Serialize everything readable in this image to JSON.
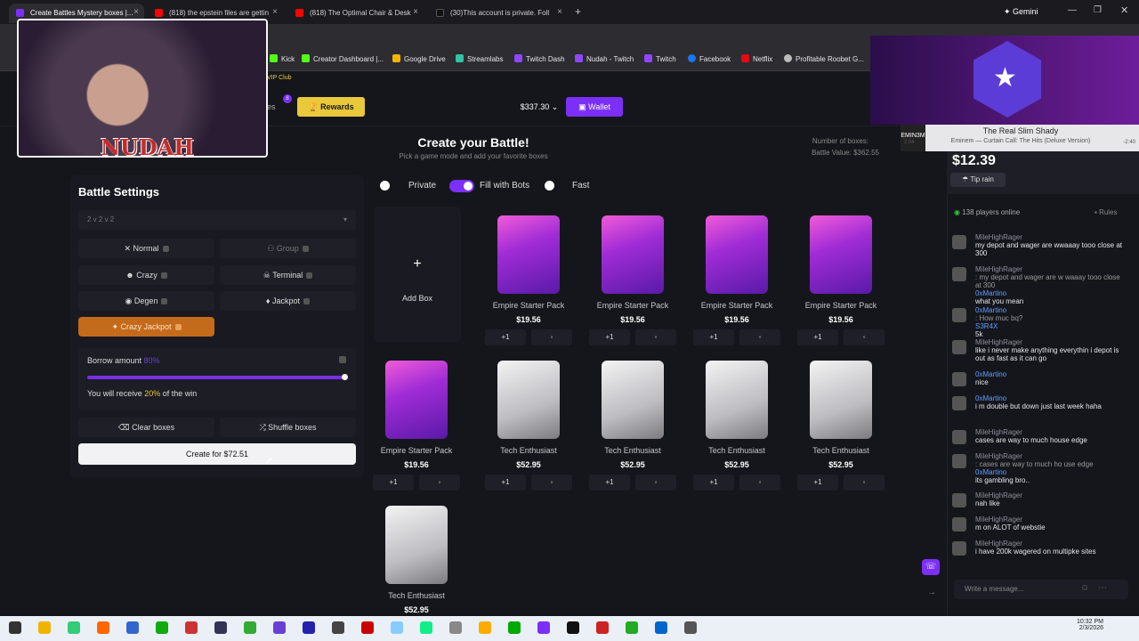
{
  "browser": {
    "tabs": [
      {
        "label": "Create Battles Mystery boxes |...",
        "color": "#7b2ff7",
        "active": true
      },
      {
        "label": "(818) the epstein files are gettin",
        "color": "#ff0000",
        "active": false
      },
      {
        "label": "(818) The Optimal Chair & Desk",
        "color": "#ff0000",
        "active": false
      },
      {
        "label": "(30)This account is private. Foll",
        "color": "#111111",
        "active": false
      }
    ],
    "gemini": "Gemini",
    "bookmarks": [
      {
        "label": "Kick",
        "color": "#53fc18"
      },
      {
        "label": "Creator Dashboard |...",
        "color": "#53fc18"
      },
      {
        "label": "Google Drive",
        "color": "#f4b400"
      },
      {
        "label": "Streamlabs",
        "color": "#31c3a2"
      },
      {
        "label": "Twitch Dash",
        "color": "#9146ff"
      },
      {
        "label": "Nudah - Twitch",
        "color": "#9146ff"
      },
      {
        "label": "Twitch",
        "color": "#9146ff"
      },
      {
        "label": "Facebook",
        "color": "#1877f2"
      },
      {
        "label": "Netflix",
        "color": "#e50914"
      },
      {
        "label": "Profitable Roobet G...",
        "color": "#bbbbbb"
      }
    ],
    "vip_club": "VIP Club"
  },
  "nav": {
    "rewards": "Rewards",
    "badge": "8",
    "nav_partial": "es",
    "balance": "$337.30",
    "wallet": "Wallet"
  },
  "settings": {
    "title": "Battle Settings",
    "mode_select": "2 v 2 v 2",
    "modes": {
      "normal": "Normal",
      "group": "Group",
      "crazy": "Crazy",
      "terminal": "Terminal",
      "degen": "Degen",
      "jackpot": "Jackpot",
      "crazy_jackpot": "Crazy Jackpot"
    },
    "borrow_label": "Borrow amount",
    "borrow_value": "80%",
    "receive_prefix": "You will receive",
    "receive_pct": "20%",
    "receive_suffix": "of the win",
    "borrow_level": 1.0,
    "clear": "Clear boxes",
    "shuffle": "Shuffle boxes",
    "create": "Create for $72.51"
  },
  "battle": {
    "title": "Create your Battle!",
    "subtitle": "Pick a game mode and add your favorite boxes",
    "num_boxes_label": "Number of boxes:",
    "value_label": "Battle Value: $362.55",
    "private": "Private",
    "fill_bots": "Fill with Bots",
    "fast": "Fast",
    "add_box": "Add Box",
    "plus": "+",
    "boxes": [
      {
        "name": "Empire Starter Pack",
        "price": "$19.56",
        "kind": "pink"
      },
      {
        "name": "Empire Starter Pack",
        "price": "$19.56",
        "kind": "pink"
      },
      {
        "name": "Empire Starter Pack",
        "price": "$19.56",
        "kind": "pink"
      },
      {
        "name": "Empire Starter Pack",
        "price": "$19.56",
        "kind": "pink"
      },
      {
        "name": "Empire Starter Pack",
        "price": "$19.56",
        "kind": "pink"
      },
      {
        "name": "Tech Enthusiast",
        "price": "$52.95",
        "kind": "tech"
      },
      {
        "name": "Tech Enthusiast",
        "price": "$52.95",
        "kind": "tech"
      },
      {
        "name": "Tech Enthusiast",
        "price": "$52.95",
        "kind": "tech"
      },
      {
        "name": "Tech Enthusiast",
        "price": "$52.95",
        "kind": "tech"
      },
      {
        "name": "Tech Enthusiast",
        "price": "$52.95",
        "kind": "tech"
      }
    ],
    "plus_one": "+1"
  },
  "stream": {
    "streamer_name": "NUDAH",
    "now_playing_title": "The Real Slim Shady",
    "now_playing_sub": "Eminem — Curtain Call: The Hits (Deluxe Version)",
    "time_elapsed": "2:04",
    "time_remaining": "-2:40",
    "tip_amount": "$12.39",
    "tip_rain": "Tip rain"
  },
  "chat": {
    "online": "138",
    "online_label": "players online",
    "rules": "Rules",
    "placeholder": "Write a message...",
    "messages": [
      {
        "user": "MileHighRager",
        "text": "my depot and wager are wwaaay tooo close at 300"
      },
      {
        "user": "MileHighRager",
        "text": ": my depot and wager are w waaay tooo close at 300",
        "reply": "0xMartino",
        "reply_text": "what you mean"
      },
      {
        "user": "0xMartino",
        "text": ": How muc bq?",
        "reply": "S3R4X",
        "reply_text": "5k"
      },
      {
        "user": "MileHighRager",
        "text": "like i never make anything everythin i depot is out as fast as it can go"
      },
      {
        "user": "0xMartino",
        "text": "nice"
      },
      {
        "user": "0xMartino",
        "text": "i m double but down just last week haha"
      },
      {
        "user": "MileHighRager",
        "text": "cases are way to much house edge"
      },
      {
        "user": "MileHighRager",
        "text": ": cases are way to much ho use edge",
        "reply": "0xMartino",
        "reply_text": "its gambling bro.."
      },
      {
        "user": "MileHighRager",
        "text": "nah like"
      },
      {
        "user": "MileHighRager",
        "text": "m on ALOT of webstie"
      },
      {
        "user": "MileHighRager",
        "text": "i have 200k wagered on multipke sites"
      }
    ]
  },
  "taskbar": {
    "time": "10:32 PM",
    "date": "2/3/2026"
  }
}
